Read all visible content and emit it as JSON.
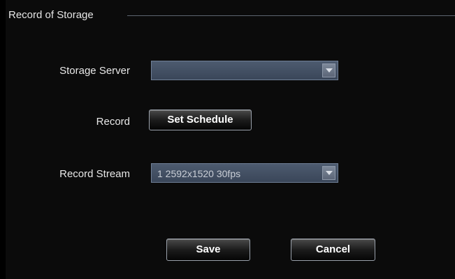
{
  "group": {
    "title": "Record of Storage"
  },
  "storage_server": {
    "label": "Storage Server",
    "value": ""
  },
  "record": {
    "label": "Record",
    "button_label": "Set Schedule"
  },
  "record_stream": {
    "label": "Record Stream",
    "value": "1 2592x1520 30fps"
  },
  "actions": {
    "save_label": "Save",
    "cancel_label": "Cancel"
  },
  "colors": {
    "background": "#0b0b0b",
    "select_fill": "#435064",
    "button_border": "#9aa1ab",
    "text": "#e8e8e8"
  }
}
